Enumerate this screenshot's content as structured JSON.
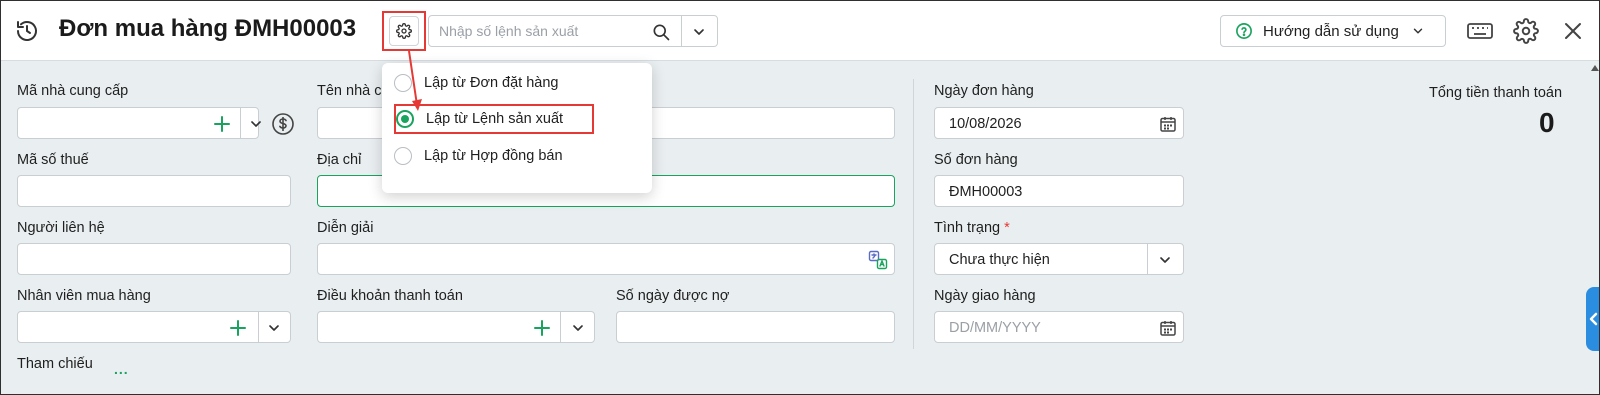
{
  "header": {
    "title": "Đơn mua hàng ĐMH00003",
    "search_placeholder": "Nhập số lệnh sản xuất",
    "guide_label": "Hướng dẫn sử dụng"
  },
  "dropdown": {
    "options": [
      {
        "label": "Lập từ Đơn đặt hàng",
        "selected": false
      },
      {
        "label": "Lập từ Lệnh sản xuất",
        "selected": true
      },
      {
        "label": "Lập từ Hợp đồng bán",
        "selected": false
      }
    ]
  },
  "form": {
    "supplier_code_label": "Mã nhà cung cấp",
    "supplier_name_label": "Tên nhà c",
    "tax_code_label": "Mã số thuế",
    "address_label": "Địa chỉ",
    "contact_label": "Người liên hệ",
    "description_label": "Diễn giải",
    "buyer_label": "Nhân viên mua hàng",
    "payment_terms_label": "Điều khoản thanh toán",
    "credit_days_label": "Số ngày được nợ",
    "reference_label": "Tham chiếu",
    "reference_more": "...",
    "order_date_label": "Ngày đơn hàng",
    "order_date_value": "10/08/2026",
    "order_no_label": "Số đơn hàng",
    "order_no_value": "ĐMH00003",
    "status_label": "Tình trạng",
    "status_required": "*",
    "status_value": "Chưa thực hiện",
    "delivery_date_label": "Ngày giao hàng",
    "delivery_date_placeholder": "DD/MM/YYYY",
    "total_label": "Tổng tiền thanh toán",
    "total_value": "0"
  },
  "colors": {
    "accent_green": "#1aa35f",
    "highlight_red": "#e53935",
    "side_tab_blue": "#2a8de0"
  }
}
